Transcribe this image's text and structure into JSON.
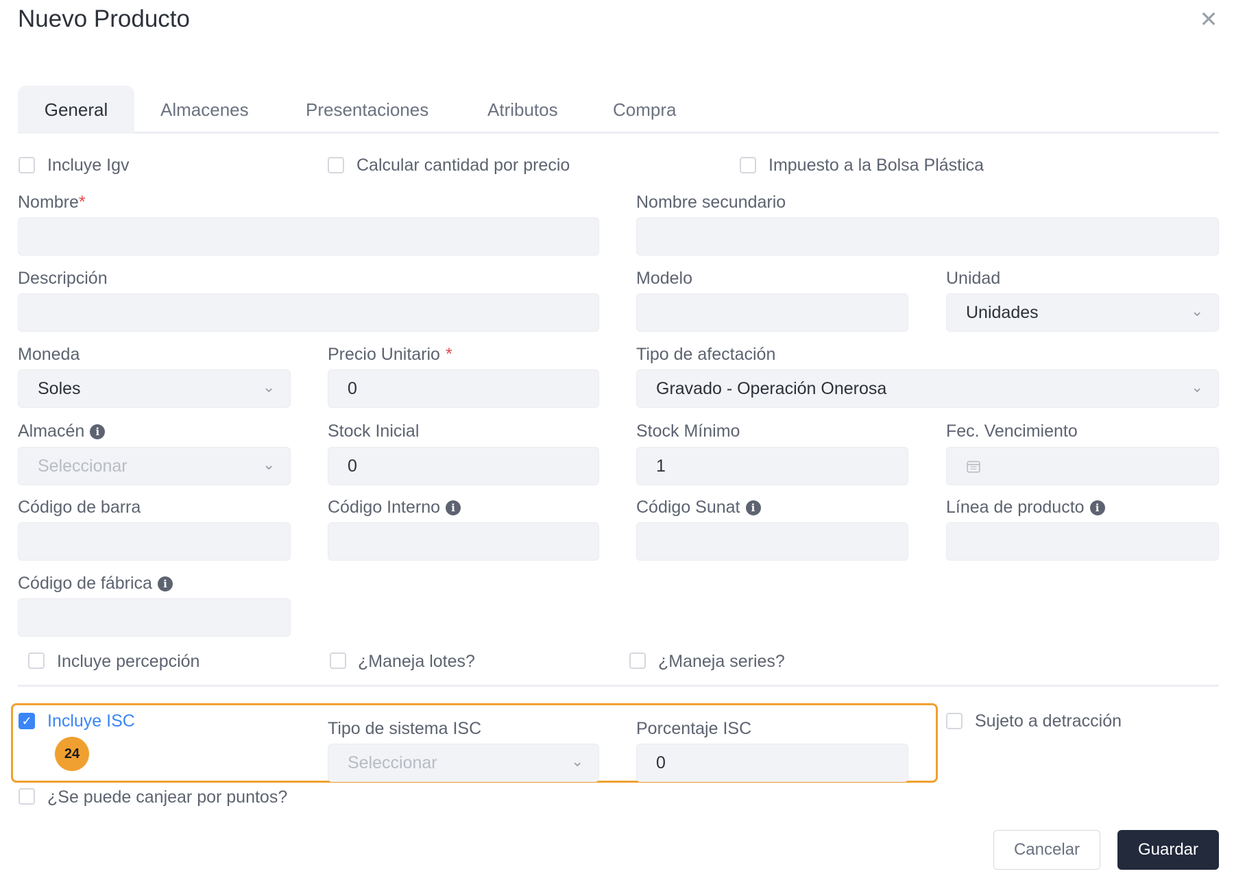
{
  "modal": {
    "title": "Nuevo Producto"
  },
  "tabs": [
    {
      "label": "General"
    },
    {
      "label": "Almacenes"
    },
    {
      "label": "Presentaciones"
    },
    {
      "label": "Atributos"
    },
    {
      "label": "Compra"
    }
  ],
  "top_checks": {
    "incluye_igv": "Incluye Igv",
    "calcular_cantidad": "Calcular cantidad por precio",
    "impuesto_bolsa": "Impuesto a la Bolsa Plástica"
  },
  "fields": {
    "nombre": {
      "label": "Nombre",
      "required": "*",
      "value": ""
    },
    "nombre_secundario": {
      "label": "Nombre secundario",
      "value": ""
    },
    "descripcion": {
      "label": "Descripción",
      "value": ""
    },
    "modelo": {
      "label": "Modelo",
      "value": ""
    },
    "unidad": {
      "label": "Unidad",
      "value": "Unidades"
    },
    "moneda": {
      "label": "Moneda",
      "value": "Soles"
    },
    "precio_unitario": {
      "label": "Precio Unitario",
      "required": "*",
      "value": "0"
    },
    "tipo_afectacion": {
      "label": "Tipo de afectación",
      "value": "Gravado - Operación Onerosa"
    },
    "almacen": {
      "label": "Almacén",
      "placeholder": "Seleccionar"
    },
    "stock_inicial": {
      "label": "Stock Inicial",
      "value": "0"
    },
    "stock_minimo": {
      "label": "Stock Mínimo",
      "value": "1"
    },
    "fec_vencimiento": {
      "label": "Fec. Vencimiento",
      "value": ""
    },
    "codigo_barra": {
      "label": "Código de barra",
      "value": ""
    },
    "codigo_interno": {
      "label": "Código Interno",
      "value": ""
    },
    "codigo_sunat": {
      "label": "Código Sunat",
      "value": ""
    },
    "linea_producto": {
      "label": "Línea de producto",
      "value": ""
    },
    "codigo_fabrica": {
      "label": "Código de fábrica",
      "value": ""
    },
    "tipo_sistema_isc": {
      "label": "Tipo de sistema ISC",
      "placeholder": "Seleccionar"
    },
    "porcentaje_isc": {
      "label": "Porcentaje ISC",
      "value": "0"
    }
  },
  "mid_checks": {
    "incluye_percepcion": "Incluye percepción",
    "maneja_lotes": "¿Maneja lotes?",
    "maneja_series": "¿Maneja series?"
  },
  "isc": {
    "label": "Incluye ISC",
    "checked": true,
    "badge": "24"
  },
  "detraccion": "Sujeto a detracción",
  "puntos": "¿Se puede canjear por puntos?",
  "buttons": {
    "cancel": "Cancelar",
    "save": "Guardar"
  },
  "icons": {
    "close": "close-icon",
    "chevron": "chevron-down-icon",
    "info": "info-icon",
    "calendar": "calendar-icon",
    "check": "check-icon"
  },
  "colors": {
    "primary": "#3a86f6",
    "highlight": "#f0a030",
    "save_button": "#222a3c"
  }
}
